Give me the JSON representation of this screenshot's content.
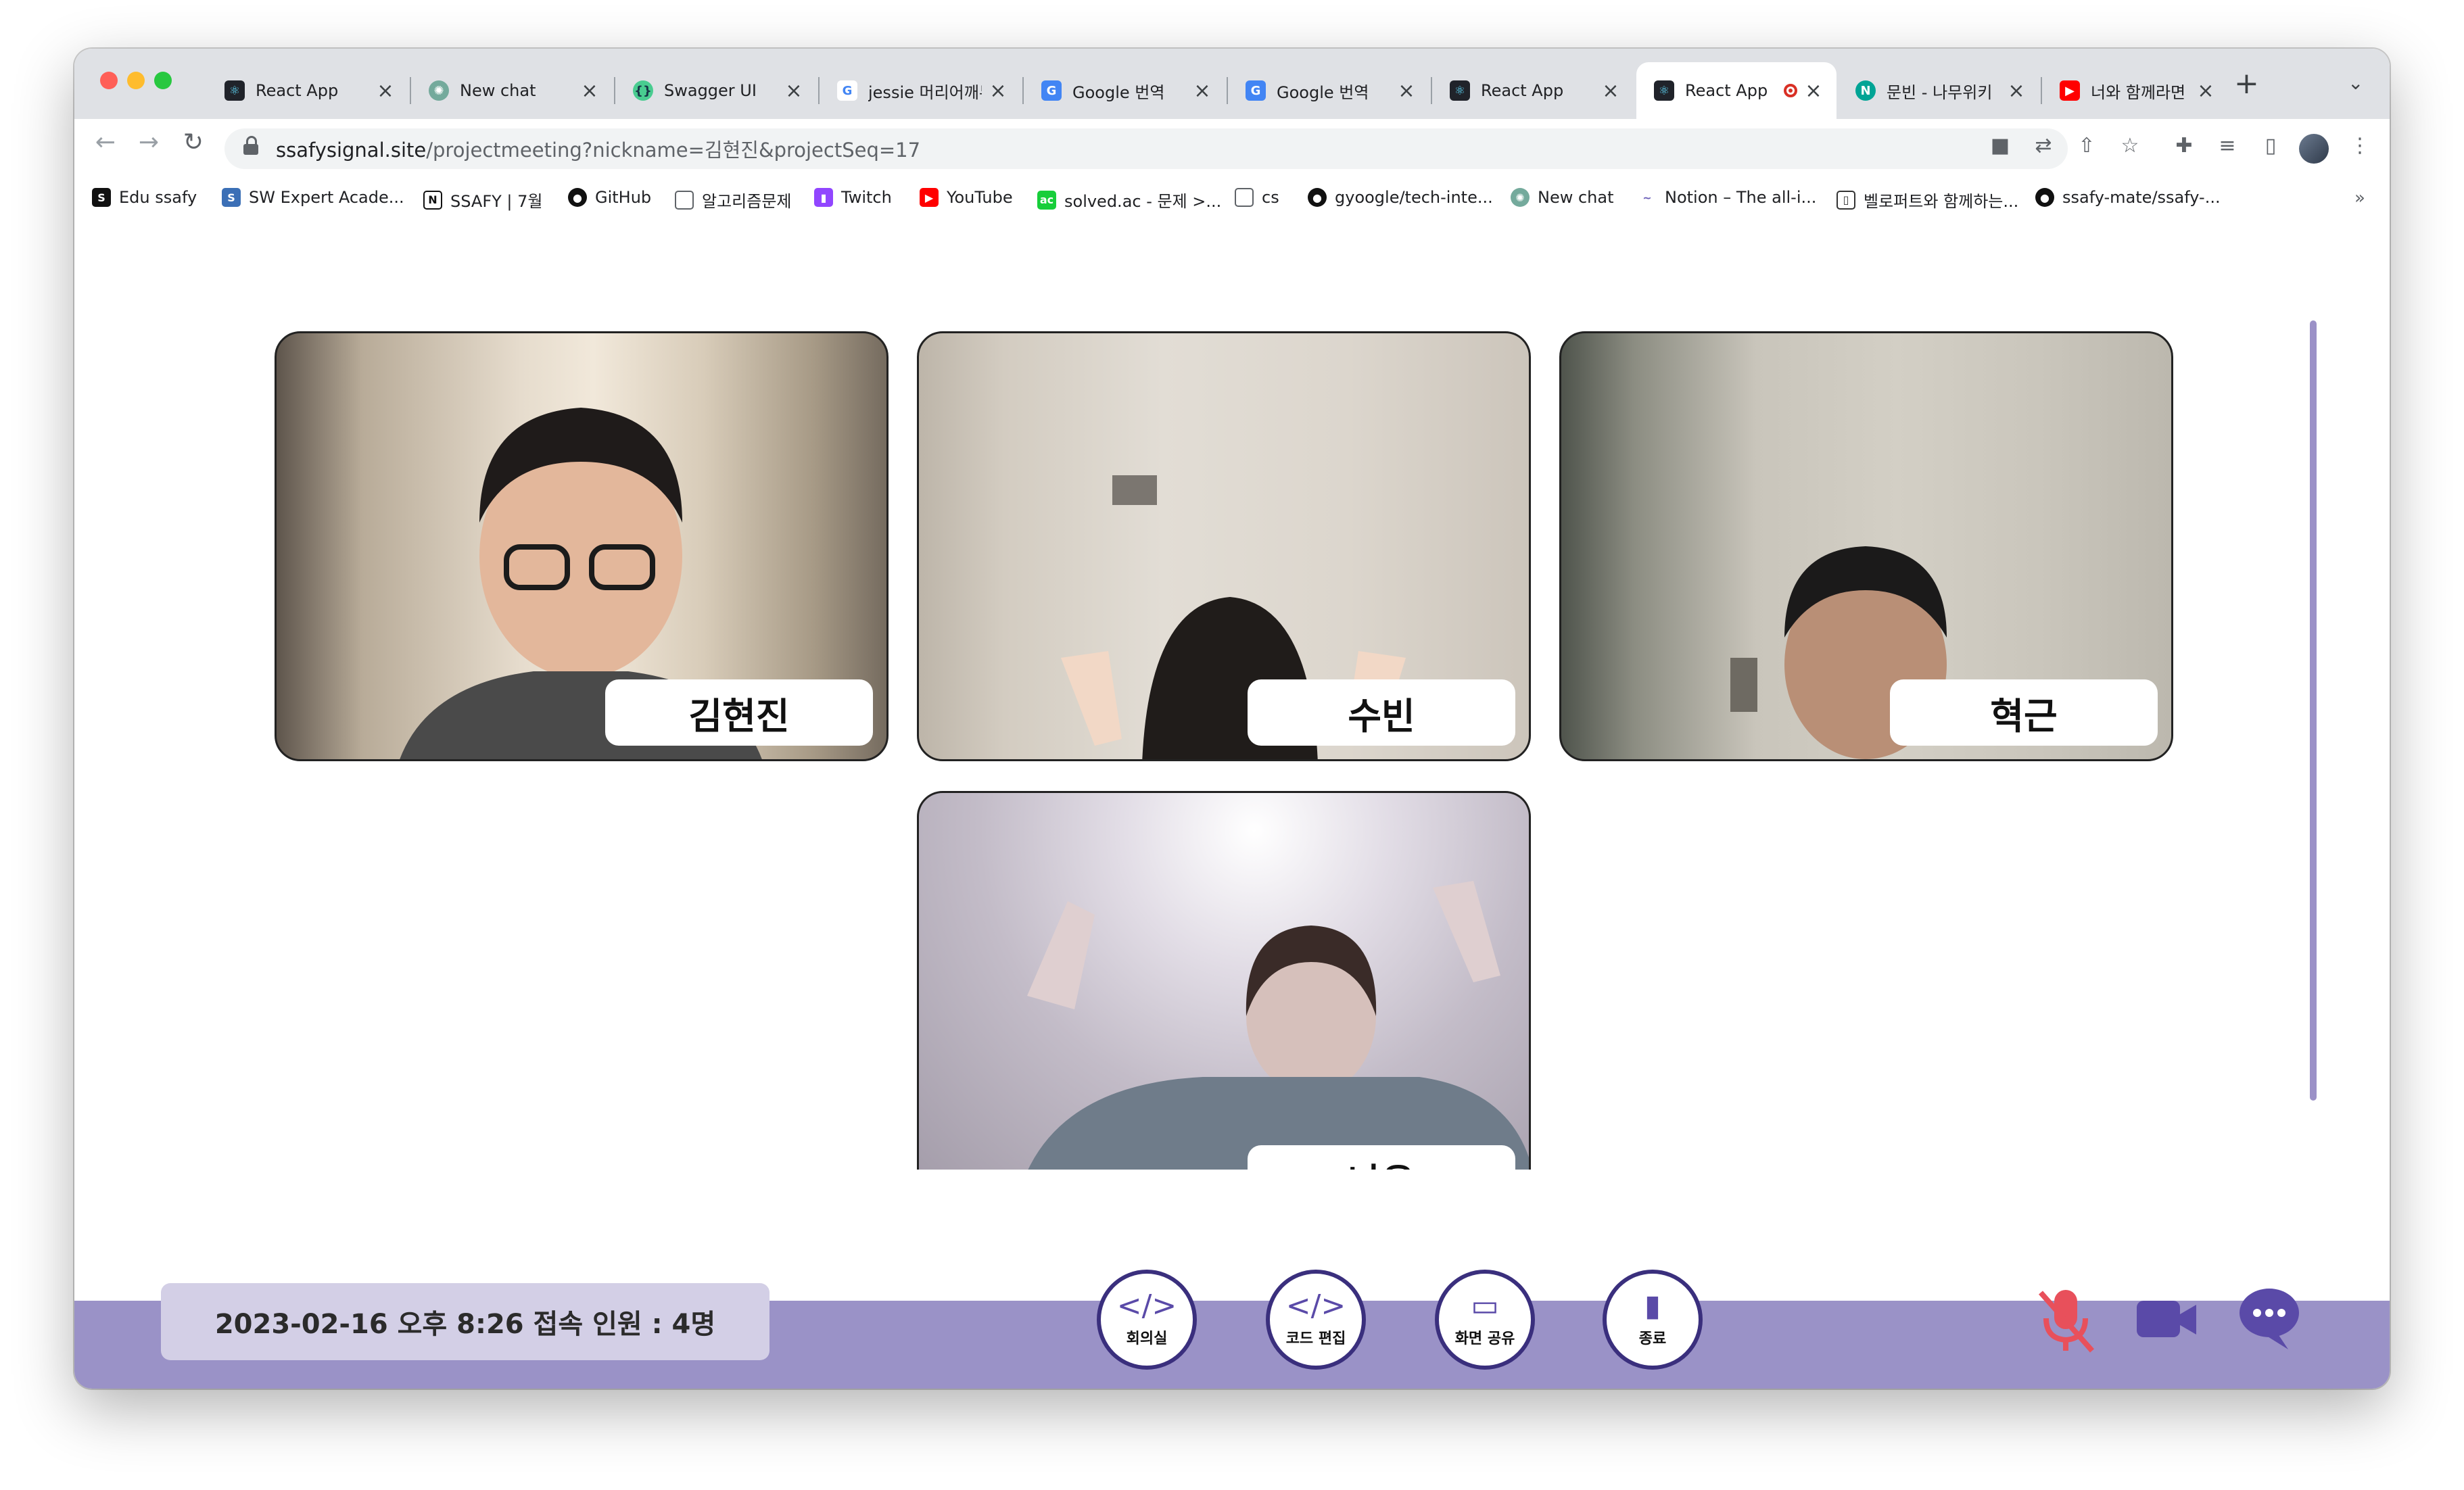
{
  "browser": {
    "tabs": [
      {
        "title": "React App",
        "icon": "react-icon",
        "icon_color": "#20232a"
      },
      {
        "title": "New chat",
        "icon": "chatgpt-icon",
        "icon_color": "#74aa9c"
      },
      {
        "title": "Swagger UI",
        "icon": "swagger-icon",
        "icon_color": "#49cc90"
      },
      {
        "title": "jessie 머리어깨무릎",
        "icon": "google-icon",
        "icon_color": "#4285f4"
      },
      {
        "title": "Google 번역",
        "icon": "google-translate-icon",
        "icon_color": "#4285f4"
      },
      {
        "title": "Google 번역",
        "icon": "google-translate-icon",
        "icon_color": "#4285f4"
      },
      {
        "title": "React App",
        "icon": "react-icon",
        "icon_color": "#20232a"
      },
      {
        "title": "React App",
        "icon": "react-icon",
        "icon_color": "#20232a",
        "active": true,
        "recording": true
      },
      {
        "title": "문빈 - 나무위키",
        "icon": "namuwiki-icon",
        "icon_color": "#00a495"
      },
      {
        "title": "너와 함께라면 - ",
        "icon": "youtube-icon",
        "icon_color": "#ff0000"
      }
    ],
    "new_tab": "+",
    "url_host": "ssafysignal.site",
    "url_rest": "/projectmeeting?nickname=김현진&projectSeq=17",
    "bookmarks": [
      {
        "label": "Edu ssafy",
        "icon": "edu-ssafy-icon"
      },
      {
        "label": "SW Expert Acade...",
        "icon": "swea-icon"
      },
      {
        "label": "SSAFY | 7월",
        "icon": "notion-icon"
      },
      {
        "label": "GitHub",
        "icon": "github-icon"
      },
      {
        "label": "알고리즘문제",
        "icon": "folder-icon"
      },
      {
        "label": "Twitch",
        "icon": "twitch-icon"
      },
      {
        "label": "YouTube",
        "icon": "youtube-icon"
      },
      {
        "label": "solved.ac - 문제 >...",
        "icon": "solvedac-icon"
      },
      {
        "label": "cs",
        "icon": "folder-icon"
      },
      {
        "label": "gyoogle/tech-inte...",
        "icon": "github-icon"
      },
      {
        "label": "New chat",
        "icon": "chatgpt-icon"
      },
      {
        "label": "Notion – The all-i...",
        "icon": "notion-icon"
      },
      {
        "label": "벨로퍼트와 함께하는...",
        "icon": "book-icon"
      },
      {
        "label": "ssafy-mate/ssafy-...",
        "icon": "github-icon"
      }
    ]
  },
  "meeting": {
    "participants": [
      {
        "name": "김현진"
      },
      {
        "name": "수빈"
      },
      {
        "name": "혁근"
      },
      {
        "name": "나은"
      }
    ],
    "status_text": "2023-02-16 오후 8:26 접속 인원 : 4명",
    "controls": [
      {
        "label": "회의실",
        "icon": "meeting-room-icon"
      },
      {
        "label": "코드 편집",
        "icon": "code-edit-icon"
      },
      {
        "label": "화면 공유",
        "icon": "screen-share-icon"
      },
      {
        "label": "종료",
        "icon": "exit-door-icon"
      }
    ],
    "media": {
      "mic": "muted",
      "camera": "on",
      "chat": "available"
    },
    "colors": {
      "bottom_bar": "#9a92c7",
      "control_border": "#3a2f7d",
      "mic_muted": "#e8505b",
      "accent": "#5a4aa8"
    }
  }
}
